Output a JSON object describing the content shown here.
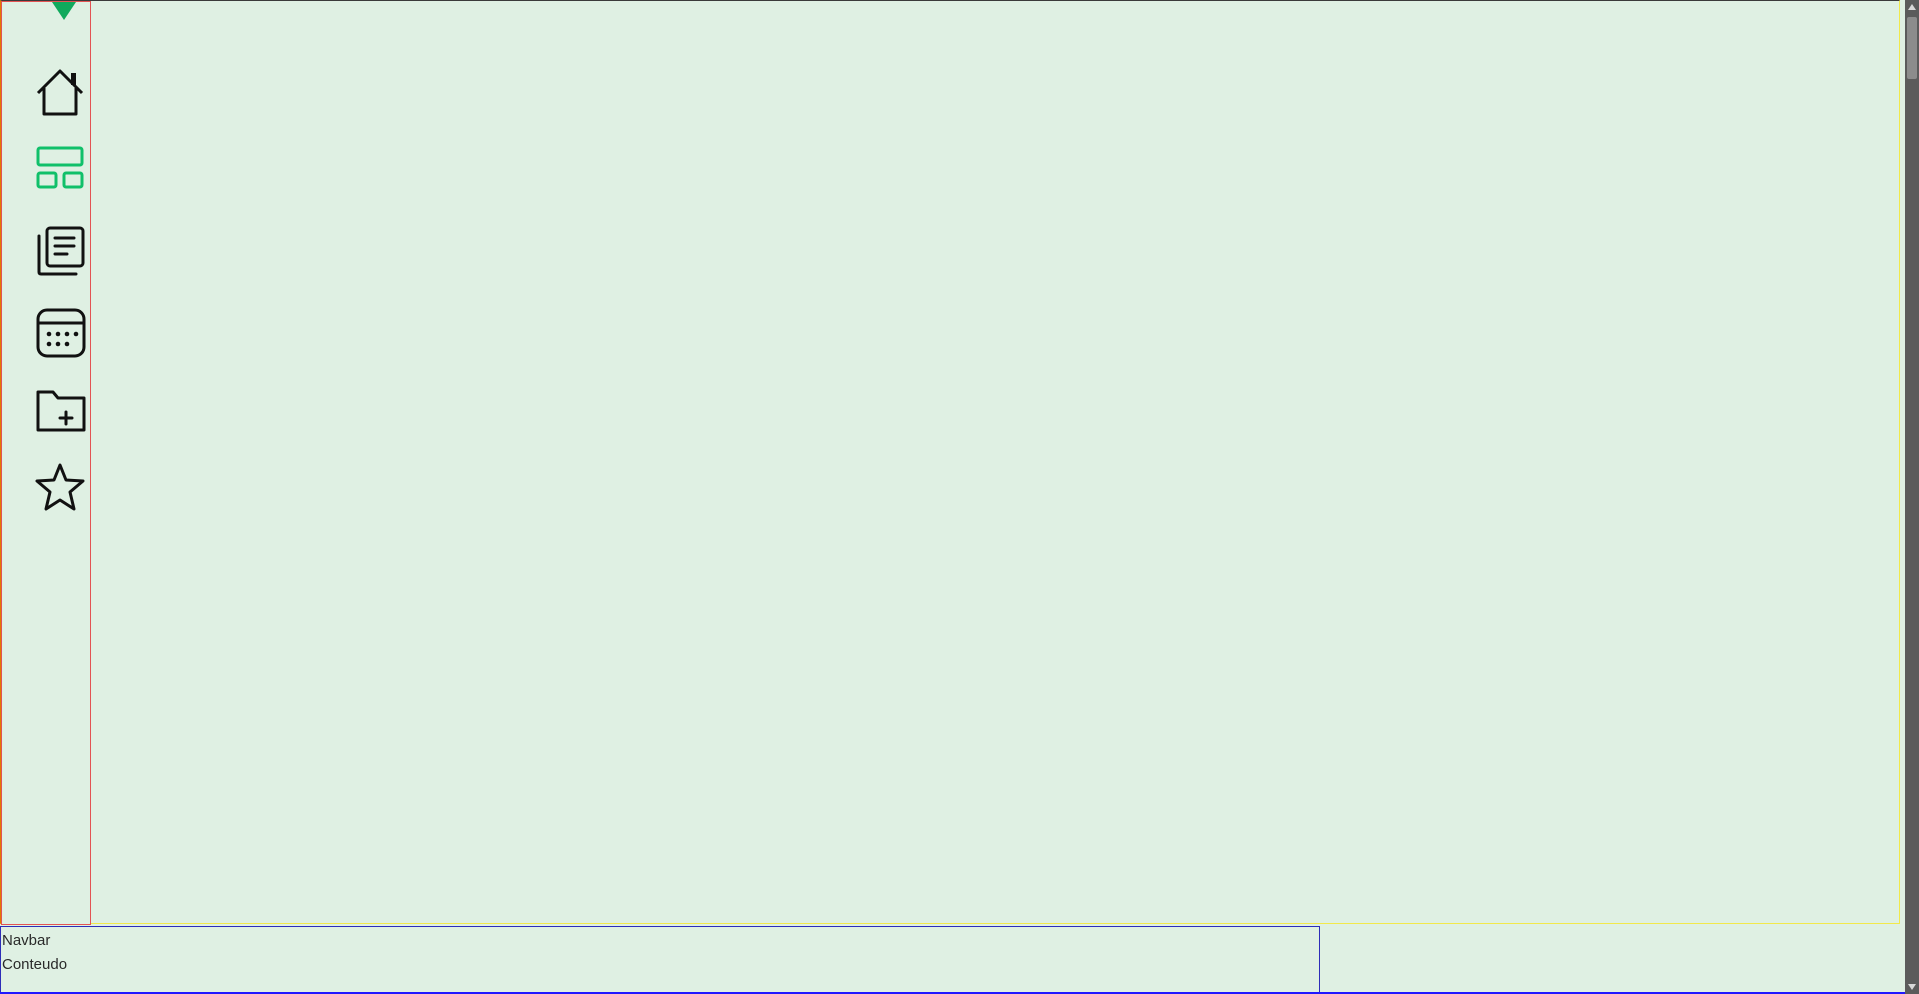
{
  "colors": {
    "background": "#dff0e3",
    "active_icon": "#10c06a",
    "default_icon": "#111111",
    "sidebar_border": "#e35353",
    "bottom_border": "#2d2db8",
    "brand_mark": "#10a95c"
  },
  "sidebar": {
    "brand_icon": "brand-triangle-icon",
    "items": [
      {
        "icon": "home-icon",
        "active": false
      },
      {
        "icon": "dashboard-icon",
        "active": true
      },
      {
        "icon": "documents-icon",
        "active": false
      },
      {
        "icon": "calendar-icon",
        "active": false
      },
      {
        "icon": "folder-add-icon",
        "active": false
      },
      {
        "icon": "star-icon",
        "active": false
      }
    ]
  },
  "bottom_panel": {
    "navbar_label": "Navbar",
    "content_label": "Conteudo"
  }
}
